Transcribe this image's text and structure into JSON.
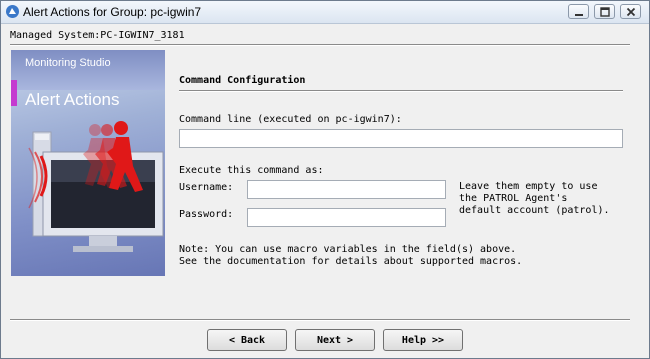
{
  "window": {
    "title": "Alert Actions for Group: pc-igwin7",
    "controls": [
      "minimize-icon",
      "maximize-icon",
      "close-icon"
    ]
  },
  "header": {
    "managed_system": "Managed System:PC-IGWIN7_3181"
  },
  "banner": {
    "product": "Monitoring Studio",
    "title": "Alert Actions",
    "art_icon": "alert-action-figure-icon"
  },
  "form": {
    "section_title": "Command Configuration",
    "command_line_label": "Command line (executed on pc-igwin7):",
    "command_line_value": "",
    "execute_as_label": "Execute this command as:",
    "username_label": "Username:",
    "username_value": "",
    "password_label": "Password:",
    "password_value": "",
    "hint": "Leave them empty to use\nthe PATROL Agent's\ndefault account (patrol).",
    "note": "Note: You can use macro variables in the field(s) above.\nSee the documentation for details about supported macros."
  },
  "buttons": {
    "back": "< Back",
    "next": "Next >",
    "help": "Help >>"
  },
  "colors": {
    "accent": "#c43bd0",
    "figure": "#e01818"
  }
}
